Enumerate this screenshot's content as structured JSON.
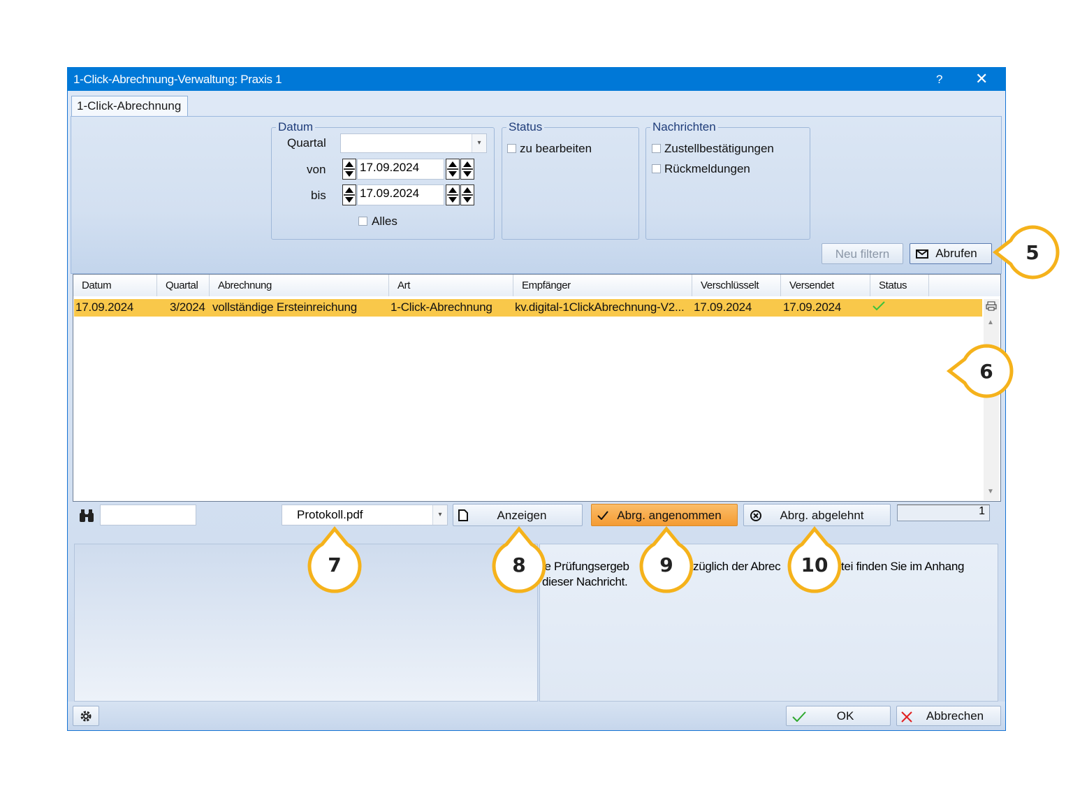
{
  "window": {
    "title": "1-Click-Abrechnung-Verwaltung: Praxis 1",
    "help_label": "?",
    "close_label": "✕",
    "tab_label": "1-Click-Abrechnung"
  },
  "filters": {
    "datum": {
      "legend": "Datum",
      "quartal_label": "Quartal",
      "quartal_value": "",
      "von_label": "von",
      "von_value": "17.09.2024",
      "bis_label": "bis",
      "bis_value": "17.09.2024",
      "alles_label": "Alles"
    },
    "status": {
      "legend": "Status",
      "zu_bearbeiten_label": "zu bearbeiten"
    },
    "nachrichten": {
      "legend": "Nachrichten",
      "zustell_label": "Zustellbestätigungen",
      "rueck_label": "Rückmeldungen"
    },
    "neu_filtern_label": "Neu filtern",
    "abrufen_label": "Abrufen"
  },
  "table": {
    "columns": [
      "Datum",
      "Quartal",
      "Abrechnung",
      "Art",
      "Empfänger",
      "Verschlüsselt",
      "Versendet",
      "Status"
    ],
    "rows": [
      {
        "datum": "17.09.2024",
        "quartal": "3/2024",
        "abrechnung": "vollständige Ersteinreichung",
        "art": "1-Click-Abrechnung",
        "empfaenger": "kv.digital-1ClickAbrechnung-V2...",
        "verschluesselt": "17.09.2024",
        "versendet": "17.09.2024",
        "status_icon": "check-icon"
      }
    ]
  },
  "toolbar": {
    "search_value": "",
    "attachment_value": "Protokoll.pdf",
    "anzeigen_label": "Anzeigen",
    "angenommen_label": "Abrg. angenommen",
    "abgelehnt_label": "Abrg. abgelehnt",
    "count_value": "1"
  },
  "message": {
    "line1": "ie Prüfungsergeb",
    "line1b": "züglich der Abrec",
    "line1c": "tei finden Sie im Anhang",
    "line2": "dieser Nachricht."
  },
  "footer": {
    "ok_label": "OK",
    "abbrechen_label": "Abbrechen"
  },
  "callouts": [
    "5",
    "6",
    "7",
    "8",
    "9",
    "10"
  ],
  "colors": {
    "titlebar": "#0078d7",
    "row_highlight": "#f9c84a",
    "callout_ring": "#f5b21b",
    "accept_button": "#f7a94b"
  }
}
